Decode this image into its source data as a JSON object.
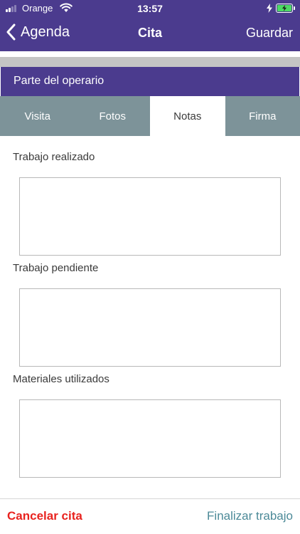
{
  "status_bar": {
    "carrier": "Orange",
    "time": "13:57",
    "battery_color": "#4cd964",
    "icons": [
      "signal-icon",
      "wifi-icon",
      "charging-icon",
      "battery-icon"
    ]
  },
  "nav": {
    "back_label": "Agenda",
    "back_icon": "chevron-left-icon",
    "title": "Cita",
    "save_label": "Guardar",
    "bar_color": "#4b3b8e"
  },
  "section": {
    "title": "Parte del operario"
  },
  "tabs": [
    {
      "label": "Visita",
      "active": false
    },
    {
      "label": "Fotos",
      "active": false
    },
    {
      "label": "Notas",
      "active": true
    },
    {
      "label": "Firma",
      "active": false
    }
  ],
  "tab_bar_color": "#7d9399",
  "notes": {
    "fields": [
      {
        "label": "Trabajo realizado",
        "value": ""
      },
      {
        "label": "Trabajo pendiente",
        "value": ""
      },
      {
        "label": "Materiales utilizados",
        "value": ""
      }
    ]
  },
  "footer": {
    "cancel_label": "Cancelar cita",
    "cancel_color": "#e8231f",
    "finish_label": "Finalizar trabajo",
    "finish_color": "#4c8a98"
  }
}
